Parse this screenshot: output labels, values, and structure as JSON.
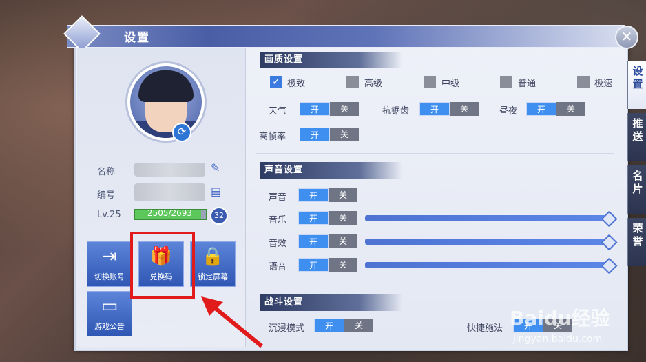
{
  "window": {
    "title": "设置",
    "close_icon": "close-icon"
  },
  "profile": {
    "name_label": "名称",
    "id_label": "编号",
    "level": "Lv.25",
    "xp": "2505/2693",
    "xp_fraction": 0.93,
    "badge": "32"
  },
  "actions": [
    {
      "label": "切换账号",
      "icon": "logout-icon"
    },
    {
      "label": "兑换码",
      "icon": "gift-icon"
    },
    {
      "label": "锁定屏幕",
      "icon": "lock-icon"
    },
    {
      "label": "游戏公告",
      "icon": "notice-board-icon"
    }
  ],
  "graphics": {
    "header": "画质设置",
    "quality": [
      {
        "label": "极致",
        "checked": true
      },
      {
        "label": "高级",
        "checked": false
      },
      {
        "label": "中级",
        "checked": false
      },
      {
        "label": "普通",
        "checked": false
      },
      {
        "label": "极速",
        "checked": false
      }
    ],
    "weather": "天气",
    "antialias": "抗锯齿",
    "daynight": "昼夜",
    "highfps": "高帧率"
  },
  "sound": {
    "header": "声音设置",
    "master": "声音",
    "music": "音乐",
    "sfx": "音效",
    "voice": "语音",
    "music_level": 1.0,
    "sfx_level": 1.0,
    "voice_level": 1.0
  },
  "battle": {
    "header": "战斗设置",
    "immersive": "沉浸模式",
    "quickcast": "快捷施法"
  },
  "toggle": {
    "on": "开",
    "off": "关"
  },
  "side_tabs": [
    {
      "label": "设置",
      "active": true
    },
    {
      "label": "推送",
      "active": false
    },
    {
      "label": "名片",
      "active": false
    },
    {
      "label": "荣誉",
      "active": false
    }
  ],
  "watermark": {
    "brand": "Baidu经验",
    "url": "jingyan.baidu.com"
  },
  "colors": {
    "accent": "#3f8ff0",
    "panel": "#e4e8f3",
    "highlight": "#e11b1b"
  }
}
